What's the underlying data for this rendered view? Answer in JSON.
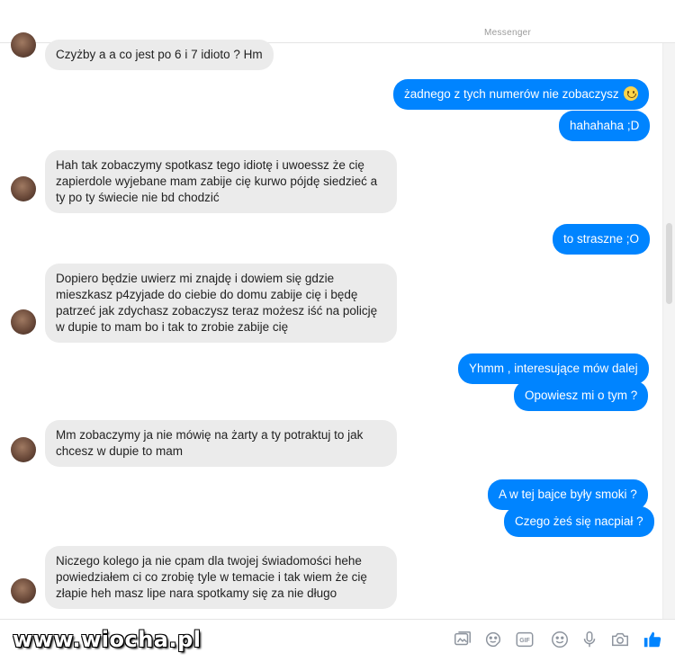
{
  "header": {
    "brand": "Messenger"
  },
  "messages": [
    {
      "dir": "in",
      "text": "Czyżby a a co jest po 6 i 7 idioto ? Hm"
    },
    {
      "dir": "out",
      "text": "żadnego z tych numerów nie zobaczysz"
    },
    {
      "dir": "out",
      "text": "hahahaha ;D"
    },
    {
      "dir": "in",
      "text": "Hah tak zobaczymy spotkasz tego idiotę i uwoessz że cię zapierdole wyjebane mam zabije cię kurwo pójdę siedzieć a ty po ty świecie nie bd chodzić"
    },
    {
      "dir": "out",
      "text": "to straszne ;O"
    },
    {
      "dir": "in",
      "text": "Dopiero będzie uwierz mi znajdę i dowiem się gdzie mieszkasz p4zyjade do ciebie do domu zabije cię i będę patrzeć jak zdychasz zobaczysz teraz możesz iść na policję w dupie to mam bo i tak to zrobie zabije cię"
    },
    {
      "dir": "out",
      "text": "Yhmm , interesujące mów dalej"
    },
    {
      "dir": "out",
      "text": "Opowiesz mi o tym ?"
    },
    {
      "dir": "in",
      "text": "Mm zobaczymy ja nie mówię na żarty a ty potraktuj to jak chcesz w dupie to mam"
    },
    {
      "dir": "out",
      "text": "A w tej bajce były smoki ?"
    },
    {
      "dir": "out",
      "text": "Czego żeś się nacpiał ?"
    },
    {
      "dir": "in",
      "text": "Niczego kolego ja nie cpam dla twojej świadomości hehe powiedziałem ci co zrobię tyle w temacie i tak wiem że cię złapie heh masz lipe nara spotkamy się za nie długo"
    }
  ],
  "emoji": "slightly-smiling-face-icon",
  "composer": {
    "tools": [
      "image-icon",
      "sticker-icon",
      "gif-icon",
      "emoji-icon",
      "microphone-icon",
      "camera-icon",
      "thumbs-up-icon"
    ],
    "gif_label": "GIF"
  },
  "watermark": "www.wiocha.pl",
  "colors": {
    "outgoing": "#0084ff",
    "incoming": "#ebebeb",
    "accent": "#0084ff"
  }
}
